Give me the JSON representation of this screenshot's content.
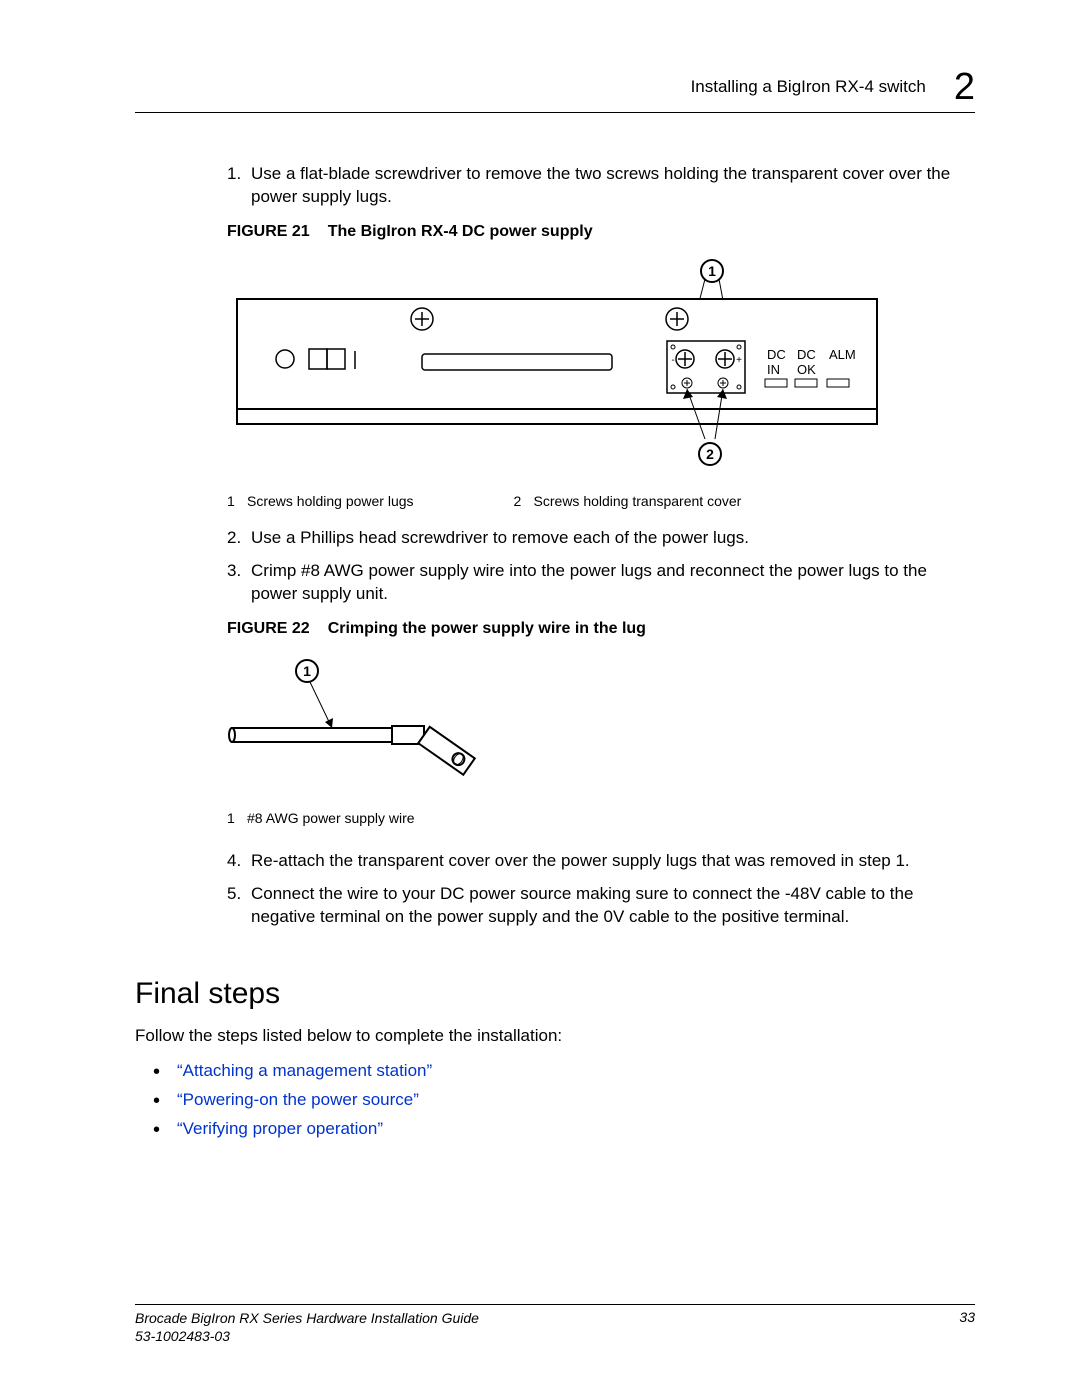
{
  "header": {
    "title": "Installing a BigIron RX-4 switch",
    "chapter": "2"
  },
  "steps": {
    "s1_num": "1.",
    "s1_txt": "Use a flat-blade screwdriver to remove the two screws holding the transparent cover over the power supply lugs.",
    "s2_num": "2.",
    "s2_txt": "Use a Phillips head screwdriver to remove each of the power lugs.",
    "s3_num": "3.",
    "s3_txt": "Crimp #8 AWG power supply wire into the power lugs and reconnect the power lugs to the power supply unit.",
    "s4_num": "4.",
    "s4_txt": "Re-attach the transparent cover over the power supply lugs that was removed in step 1.",
    "s5_num": "5.",
    "s5_txt": "Connect the wire to your DC power source making sure to connect the -48V cable to the negative terminal on the power supply and the 0V cable to the positive terminal."
  },
  "figure21": {
    "label": "FIGURE 21",
    "caption": "The BigIron RX-4 DC power supply",
    "legend": {
      "n1": "1",
      "t1": "Screws holding power lugs",
      "n2": "2",
      "t2": "Screws holding transparent cover"
    },
    "labels": {
      "dc_in": "DC",
      "dc_in2": "IN",
      "dc_ok": "DC",
      "dc_ok2": "OK",
      "alm": "ALM"
    }
  },
  "figure22": {
    "label": "FIGURE 22",
    "caption": "Crimping the power supply wire in the lug",
    "legend": {
      "n1": "1",
      "t1": "#8 AWG power supply wire"
    }
  },
  "final_steps": {
    "heading": "Final steps",
    "intro": "Follow the steps listed below to complete the installation:",
    "links": {
      "l1": "“Attaching a management station”",
      "l2": "“Powering-on the power source”",
      "l3": "“Verifying proper operation”"
    }
  },
  "footer": {
    "line1": "Brocade BigIron RX Series Hardware Installation Guide",
    "line2": "53-1002483-03",
    "page": "33"
  }
}
